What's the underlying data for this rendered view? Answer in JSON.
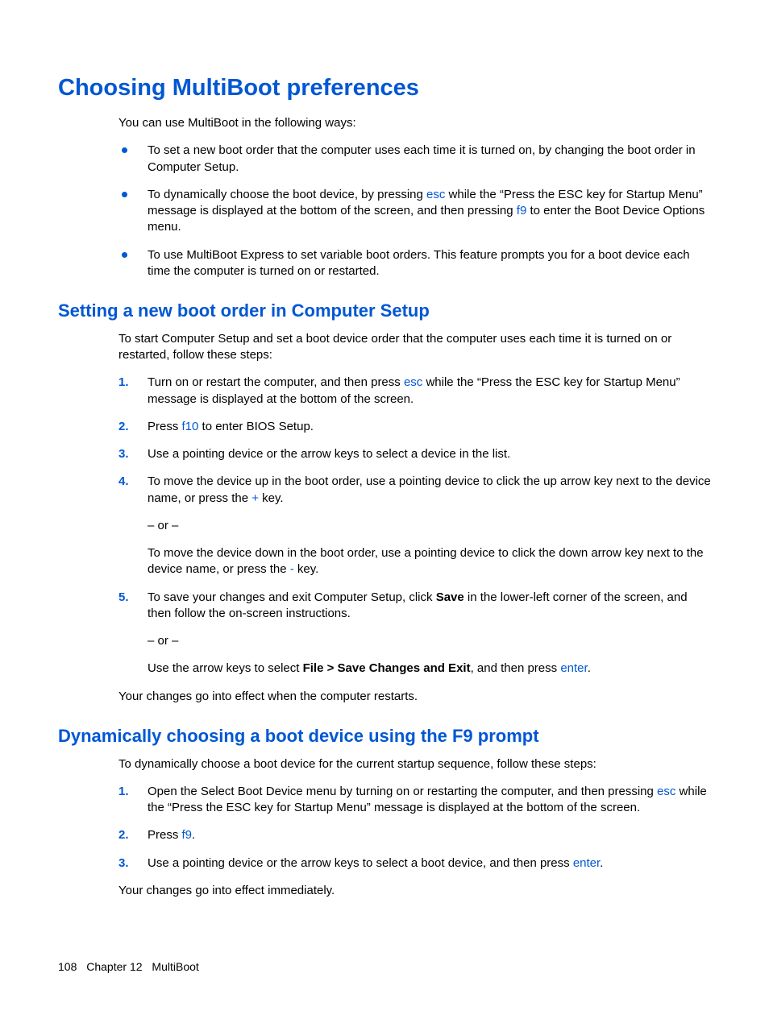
{
  "h1": "Choosing MultiBoot preferences",
  "intro": "You can use MultiBoot in the following ways:",
  "bullets": {
    "b1_a": "To set a new boot order that the computer uses each time it is turned on, by changing the boot order in Computer Setup.",
    "b2_a": "To dynamically choose the boot device, by pressing ",
    "b2_key1": "esc",
    "b2_b": " while the “Press the ESC key for Startup Menu” message is displayed at the bottom of the screen, and then pressing ",
    "b2_key2": "f9",
    "b2_c": " to enter the Boot Device Options menu.",
    "b3_a": "To use MultiBoot Express to set variable boot orders. This feature prompts you for a boot device each time the computer is turned on or restarted."
  },
  "sec1": {
    "h2": "Setting a new boot order in Computer Setup",
    "intro": "To start Computer Setup and set a boot device order that the computer uses each time it is turned on or restarted, follow these steps:",
    "s1_a": "Turn on or restart the computer, and then press ",
    "s1_key": "esc",
    "s1_b": " while the “Press the ESC key for Startup Menu” message is displayed at the bottom of the screen.",
    "s2_a": "Press ",
    "s2_key": "f10",
    "s2_b": " to enter BIOS Setup.",
    "s3": "Use a pointing device or the arrow keys to select a device in the list.",
    "s4_a": "To move the device up in the boot order, use a pointing device to click the up arrow key next to the device name, or press the ",
    "s4_key1": "+",
    "s4_b": " key.",
    "s4_or": "– or –",
    "s4_c": "To move the device down in the boot order, use a pointing device to click the down arrow key next to the device name, or press the ",
    "s4_key2": "-",
    "s4_d": " key.",
    "s5_a": "To save your changes and exit Computer Setup, click ",
    "s5_bold": "Save",
    "s5_b": " in the lower-left corner of the screen, and then follow the on-screen instructions.",
    "s5_or": "– or –",
    "s5_c": "Use the arrow keys to select ",
    "s5_bold2": "File > Save Changes and Exit",
    "s5_d": ", and then press ",
    "s5_key": "enter",
    "s5_e": ".",
    "outro": "Your changes go into effect when the computer restarts."
  },
  "sec2": {
    "h2": "Dynamically choosing a boot device using the F9 prompt",
    "intro": "To dynamically choose a boot device for the current startup sequence, follow these steps:",
    "s1_a": "Open the Select Boot Device menu by turning on or restarting the computer, and then pressing ",
    "s1_key": "esc",
    "s1_b": " while the “Press the ESC key for Startup Menu” message is displayed at the bottom of the screen.",
    "s2_a": "Press ",
    "s2_key": "f9",
    "s2_b": ".",
    "s3_a": "Use a pointing device or the arrow keys to select a boot device, and then press ",
    "s3_key": "enter",
    "s3_b": ".",
    "outro": "Your changes go into effect immediately."
  },
  "footer": {
    "page": "108",
    "chapter": "Chapter 12",
    "title": "MultiBoot"
  }
}
